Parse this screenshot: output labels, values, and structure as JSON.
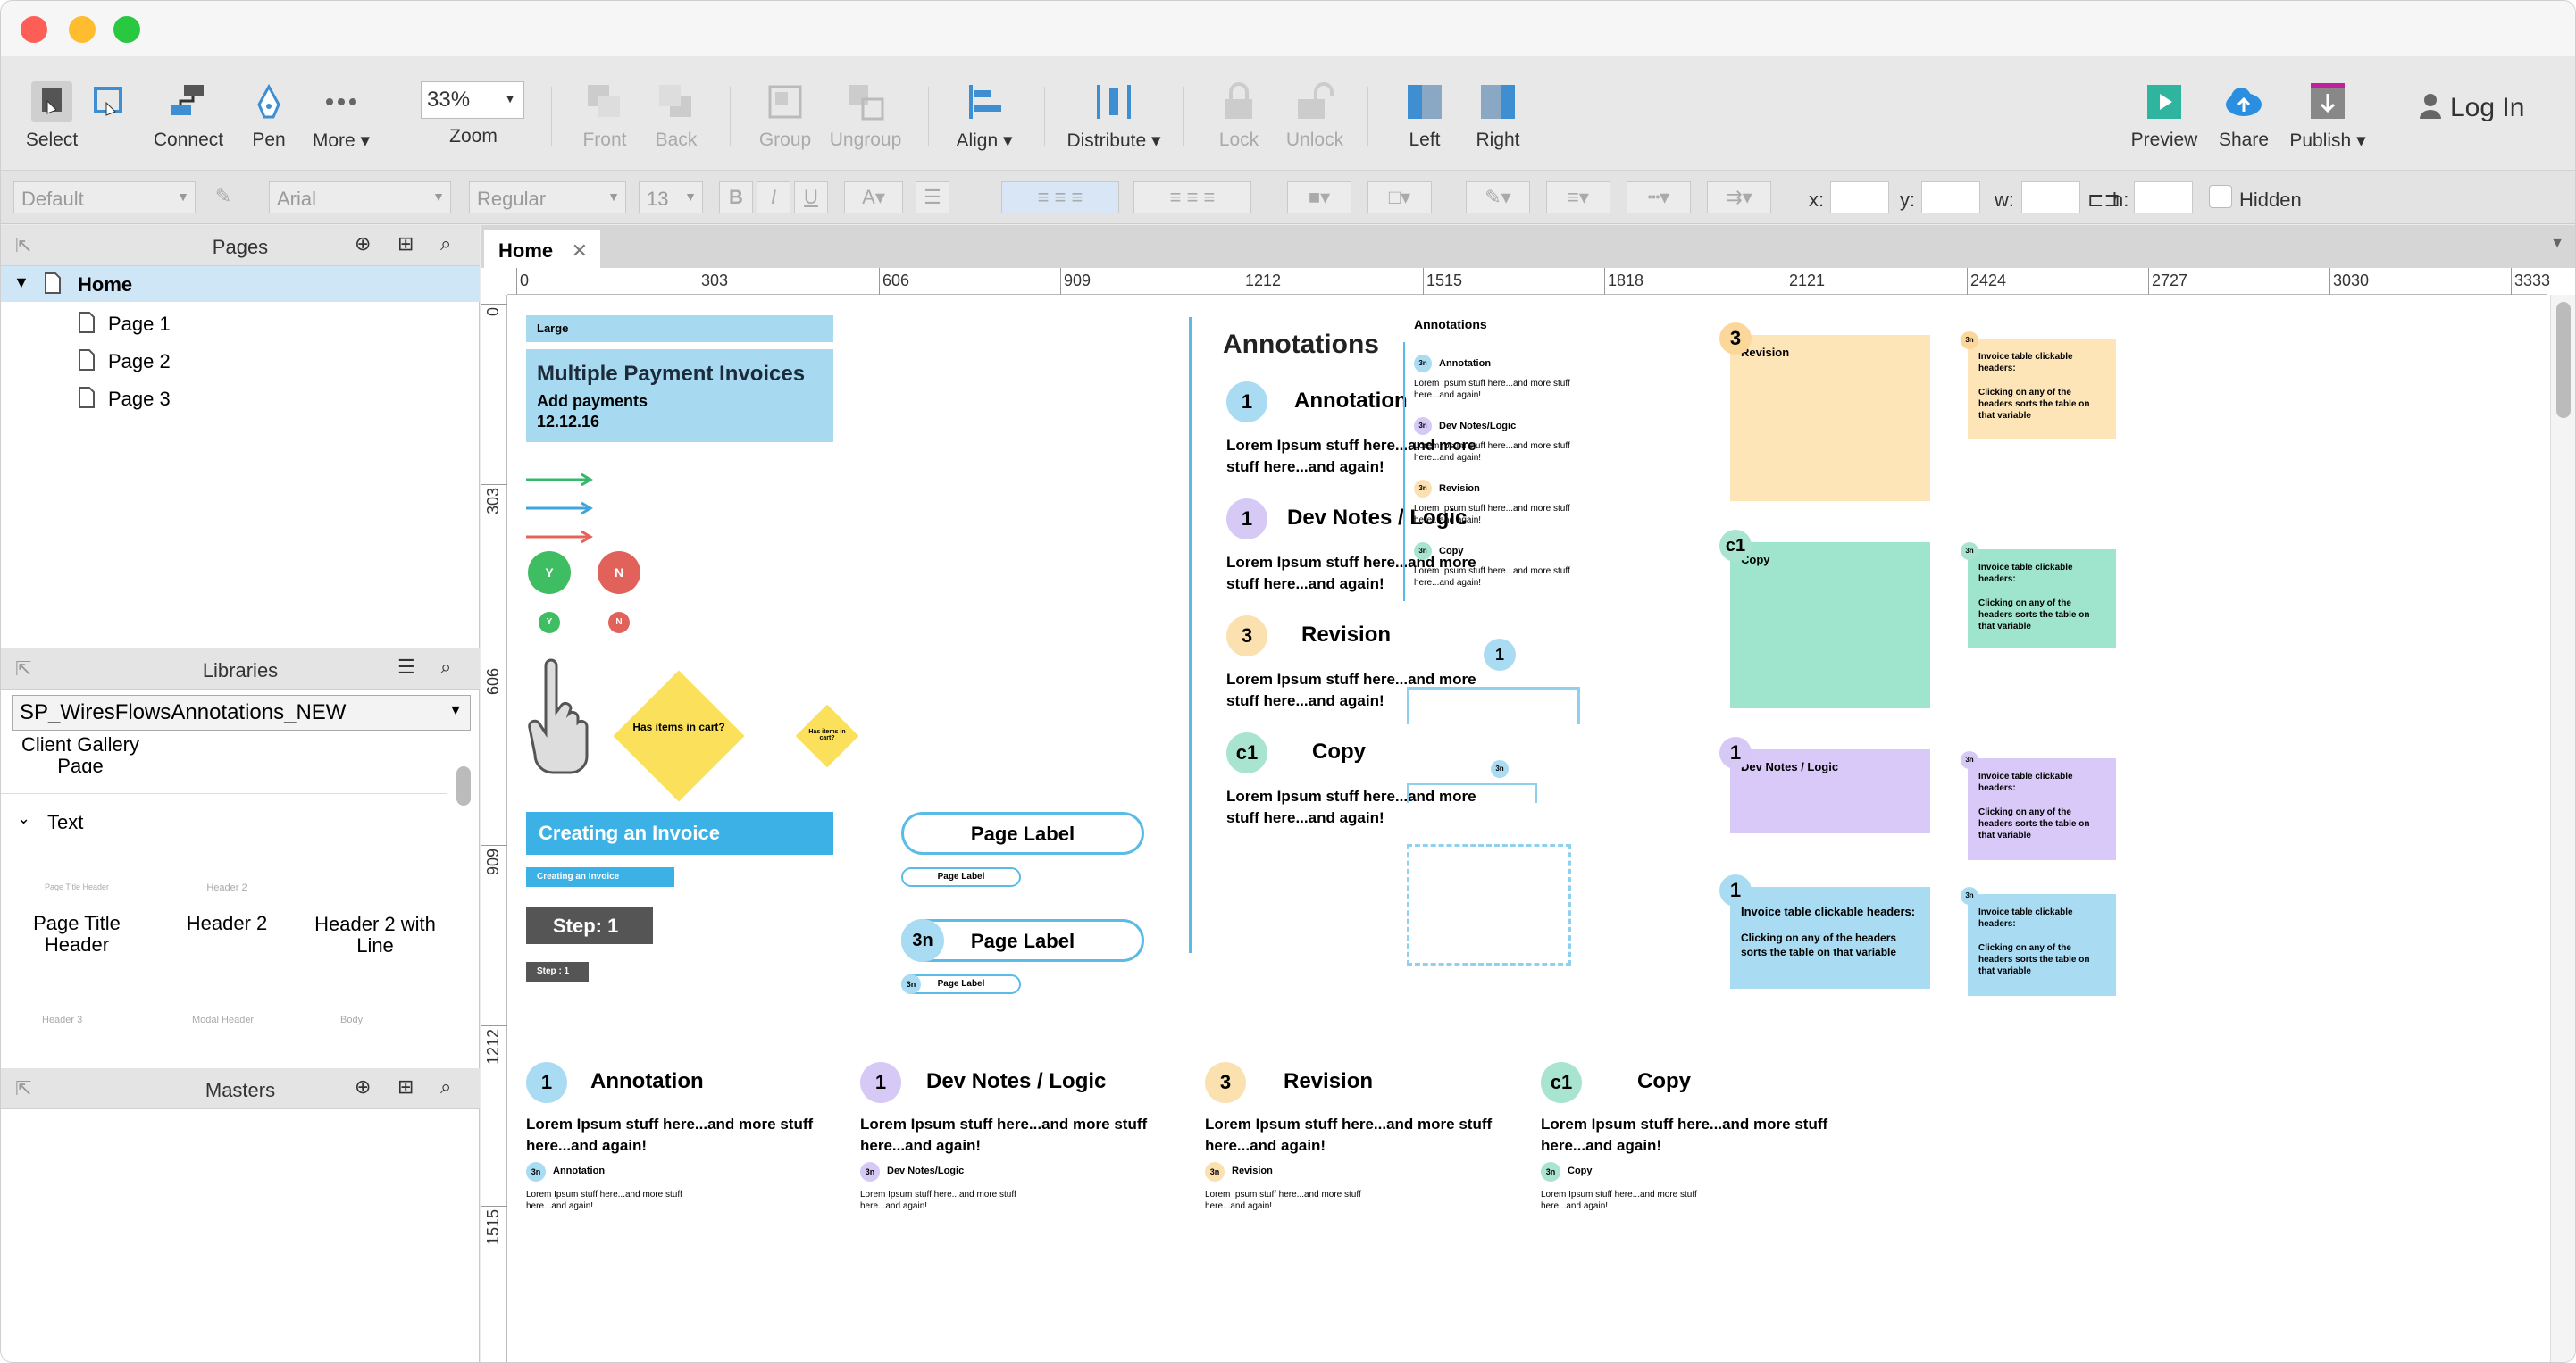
{
  "toolbar": {
    "select": "Select",
    "connect": "Connect",
    "pen": "Pen",
    "more": "More ▾",
    "zoom_value": "33%",
    "zoom": "Zoom",
    "front": "Front",
    "back": "Back",
    "group": "Group",
    "ungroup": "Ungroup",
    "align": "Align ▾",
    "distribute": "Distribute ▾",
    "lock": "Lock",
    "unlock": "Unlock",
    "left": "Left",
    "right": "Right",
    "preview": "Preview",
    "share": "Share",
    "publish": "Publish ▾",
    "login": "Log In"
  },
  "format": {
    "style": "Default",
    "font": "Arial",
    "weight": "Regular",
    "size": "13",
    "x": "x:",
    "y": "y:",
    "w": "w:",
    "h": "h:",
    "hidden": "Hidden"
  },
  "pages": {
    "title": "Pages",
    "home": "Home",
    "items": [
      "Page 1",
      "Page 2",
      "Page 3"
    ]
  },
  "libraries": {
    "title": "Libraries",
    "selected": "SP_WiresFlowsAnnotations_NEW",
    "client": "Client Gallery\nPage",
    "section": "Text",
    "items": [
      {
        "thumb": "Page Title Header",
        "label": "Page Title\nHeader"
      },
      {
        "thumb": "Header 2",
        "label": "Header 2"
      },
      {
        "thumb": "",
        "label": "Header 2 with\nLine"
      }
    ],
    "row2": [
      "Header 3",
      "Modal Header",
      "Body"
    ]
  },
  "masters": {
    "title": "Masters"
  },
  "tab": {
    "label": "Home"
  },
  "ruler_h": [
    "0",
    "303",
    "606",
    "909",
    "1212",
    "1515",
    "1818",
    "2121",
    "2424",
    "2727",
    "3030",
    "3333"
  ],
  "ruler_v": [
    "0",
    "303",
    "606",
    "909",
    "1212",
    "1515"
  ],
  "canvas": {
    "large": "Large",
    "invoice_title": "Multiple Payment Invoices",
    "invoice_sub": "Add payments",
    "invoice_date": "12.12.16",
    "y": "Y",
    "n": "N",
    "decision": "Has items in cart?",
    "decision_small": "Has items in cart?",
    "creating": "Creating an Invoice",
    "creating_small": "Creating an Invoice",
    "step": "Step: 1",
    "step_small": "Step : 1",
    "page_label": "Page Label",
    "page_label_small": "Page Label",
    "page_label_3n": "Page Label",
    "page_label_3n_small": "Page Label",
    "ann_heading": "Annotations",
    "annotations": [
      {
        "badge": "1",
        "title": "Annotation",
        "body": "Lorem Ipsum stuff here...and more stuff here...and again!",
        "color": "#a9dcf3",
        "small": "Annotation"
      },
      {
        "badge": "1",
        "title": "Dev Notes / Logic",
        "body": "Lorem Ipsum stuff here...and more stuff here...and again!",
        "color": "#d6c9f6",
        "small": "Dev Notes/Logic"
      },
      {
        "badge": "3",
        "title": "Revision",
        "body": "Lorem Ipsum stuff here...and more stuff here...and again!",
        "color": "#fbe0b0",
        "small": "Revision"
      },
      {
        "badge": "c1",
        "title": "Copy",
        "body": "Lorem Ipsum stuff here...and more stuff here...and again!",
        "color": "#a8e4cf",
        "small": "Copy"
      }
    ],
    "mini_heading": "Annotations",
    "mini_body": "Lorem Ipsum stuff here...and more stuff here...and again!",
    "badge_3n": "3n",
    "badge_1": "1",
    "stickies": [
      {
        "badge": "3",
        "label": "Revision",
        "color": "#fde5b8",
        "bcolor": "#fbd89a"
      },
      {
        "badge": "c1",
        "label": "Copy",
        "color": "#9fe5cd",
        "bcolor": "#a8e4cf"
      },
      {
        "badge": "1",
        "label": "Dev Notes / Logic",
        "color": "#d9c9f8",
        "bcolor": "#d6c9f6"
      },
      {
        "badge": "1",
        "label": "Invoice table clickable headers:",
        "sub": "Clicking on any of the headers sorts the table on that variable",
        "color": "#a9dcf3",
        "bcolor": "#a9dcf3"
      }
    ],
    "small_note_title": "Invoice table clickable headers:",
    "small_note_body": "Clicking on any of the headers sorts the table on that variable",
    "small_note_colors": [
      "#fde5b8",
      "#9fe5cd",
      "#d9c9f8",
      "#a9dcf3"
    ]
  }
}
